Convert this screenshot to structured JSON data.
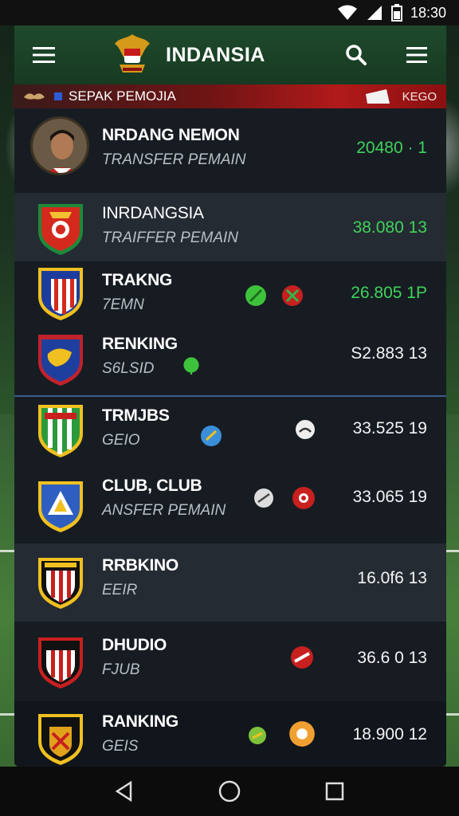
{
  "status": {
    "time": "18:30",
    "icons": [
      "wifi-icon",
      "signal-icon",
      "battery-icon"
    ]
  },
  "header": {
    "title": "INDANSIA",
    "icons": [
      "menu-icon",
      "crest-logo",
      "search-icon",
      "list-icon"
    ]
  },
  "banner": {
    "label": "SEPAK PEMOJIA",
    "code": "KEGO"
  },
  "rows": [
    {
      "name": "NRDANG NEMON",
      "sub": "TRANSFER PEMAIN",
      "score": "20480 · 1",
      "score_color": "#3fd35a"
    },
    {
      "name": "INRDANGSIA",
      "sub": "TRAIFFER PEMAIN",
      "score": "38.080 13",
      "score_color": "#3fd35a"
    },
    {
      "name": "TRAKNG",
      "sub": "7EMN",
      "score": "26.805 1P",
      "score_color": "#3fd35a"
    },
    {
      "name": "RENKING",
      "sub": "S6LSID",
      "score": "S2.883 13",
      "score_color": "#f4f4f4"
    },
    {
      "name": "TRMJBS",
      "sub": "GEIO",
      "score": "33.525 19",
      "score_color": "#f4f4f4"
    },
    {
      "name": "CLUB, CLUB",
      "sub": "ANSFER PEMAIN",
      "score": "33.065 19",
      "score_color": "#f4f4f4"
    },
    {
      "name": "RRBKINO",
      "sub": "EEIR",
      "score": "16.0f6 13",
      "score_color": "#f4f4f4"
    },
    {
      "name": "DHUDIO",
      "sub": "FJUB",
      "score": "36.6 0 13",
      "score_color": "#f4f4f4"
    },
    {
      "name": "RANKING",
      "sub": "GEIS",
      "score": "18.900 12",
      "score_color": "#f4f4f4"
    }
  ],
  "navbar": {
    "icons": [
      "back-icon",
      "home-icon",
      "recents-icon"
    ]
  }
}
